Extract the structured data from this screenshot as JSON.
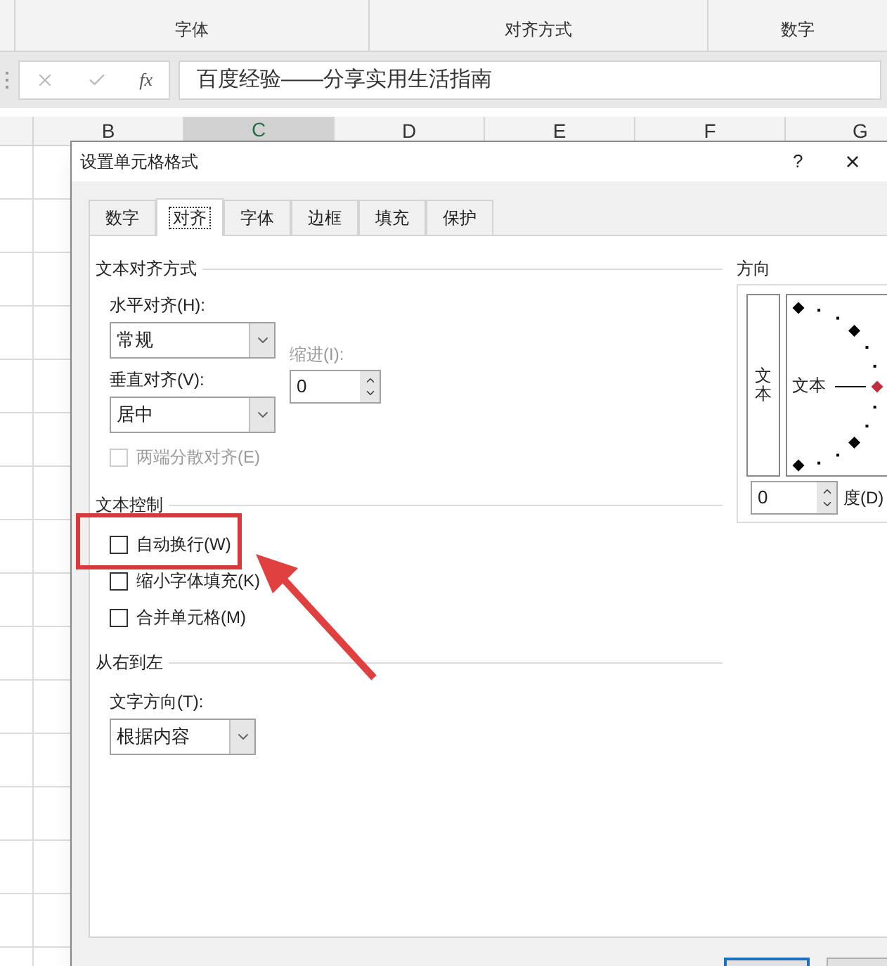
{
  "ribbon": {
    "groups": [
      {
        "label": "字体"
      },
      {
        "label": "对齐方式"
      },
      {
        "label": "数字"
      }
    ]
  },
  "formula_bar": {
    "function_label": "fx",
    "value": "百度经验——分享实用生活指南"
  },
  "columns": [
    {
      "label": "B",
      "selected": false
    },
    {
      "label": "C",
      "selected": true
    },
    {
      "label": "D",
      "selected": false
    },
    {
      "label": "E",
      "selected": false
    },
    {
      "label": "F",
      "selected": false
    },
    {
      "label": "G",
      "selected": false
    }
  ],
  "dialog": {
    "title": "设置单元格格式",
    "help": "?",
    "close": "×",
    "tabs": [
      {
        "label": "数字",
        "selected": false
      },
      {
        "label": "对齐",
        "selected": true
      },
      {
        "label": "字体",
        "selected": false
      },
      {
        "label": "边框",
        "selected": false
      },
      {
        "label": "填充",
        "selected": false
      },
      {
        "label": "保护",
        "selected": false
      }
    ],
    "text_alignment": {
      "title": "文本对齐方式",
      "horizontal_label": "水平对齐(H):",
      "horizontal_value": "常规",
      "vertical_label": "垂直对齐(V):",
      "vertical_value": "居中",
      "indent_label": "缩进(I):",
      "indent_value": "0",
      "distributed": {
        "label": "两端分散对齐(E)",
        "checked": false,
        "disabled": true
      }
    },
    "text_control": {
      "title": "文本控制",
      "options": [
        {
          "label": "自动换行(W)",
          "checked": false,
          "highlighted": true
        },
        {
          "label": "缩小字体填充(K)",
          "checked": false,
          "highlighted": false
        },
        {
          "label": "合并单元格(M)",
          "checked": false,
          "highlighted": false
        }
      ]
    },
    "right_to_left": {
      "title": "从右到左",
      "direction_label": "文字方向(T):",
      "direction_value": "根据内容"
    },
    "orientation": {
      "title": "方向",
      "vertical_text": "文本",
      "dial_text": "文本",
      "degrees_value": "0",
      "degrees_label": "度(D)"
    }
  }
}
